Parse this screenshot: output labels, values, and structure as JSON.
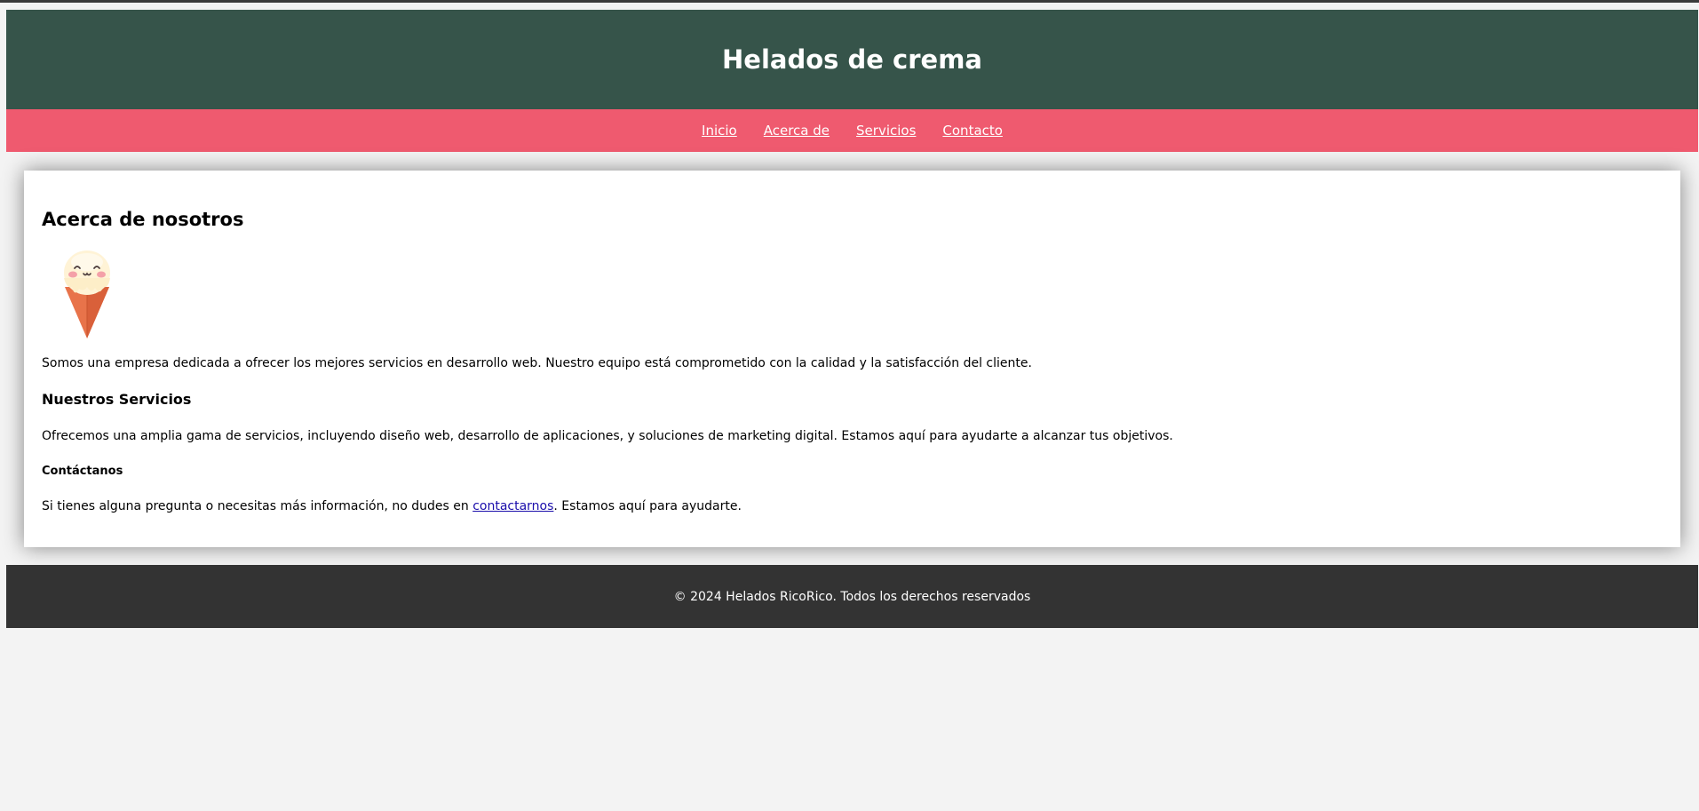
{
  "header": {
    "title": "Helados de crema"
  },
  "nav": {
    "items": [
      {
        "label": "Inicio"
      },
      {
        "label": "Acerca de"
      },
      {
        "label": "Servicios"
      },
      {
        "label": "Contacto"
      }
    ]
  },
  "main": {
    "about_heading": "Acerca de nosotros",
    "about_text": "Somos una empresa dedicada a ofrecer los mejores servicios en desarrollo web. Nuestro equipo está comprometido con la calidad y la satisfacción del cliente.",
    "services_heading": "Nuestros Servicios",
    "services_text": "Ofrecemos una amplia gama de servicios, incluyendo diseño web, desarrollo de aplicaciones, y soluciones de marketing digital. Estamos aquí para ayudarte a alcanzar tus objetivos.",
    "contact_heading": "Contáctanos",
    "contact_text_before": "Si tienes alguna pregunta o necesitas más información, no dudes en ",
    "contact_link": "contactarnos",
    "contact_text_after": ". Estamos aquí para ayudarte."
  },
  "footer": {
    "copyright": "© 2024 Helados RicoRico. Todos los derechos reservados"
  },
  "colors": {
    "header_bg": "#36544a",
    "nav_bg": "#ef5a6f",
    "footer_bg": "#333333",
    "page_bg": "#f3f3f3"
  },
  "icons": {
    "illustration": "ice-cream-cone-icon"
  }
}
